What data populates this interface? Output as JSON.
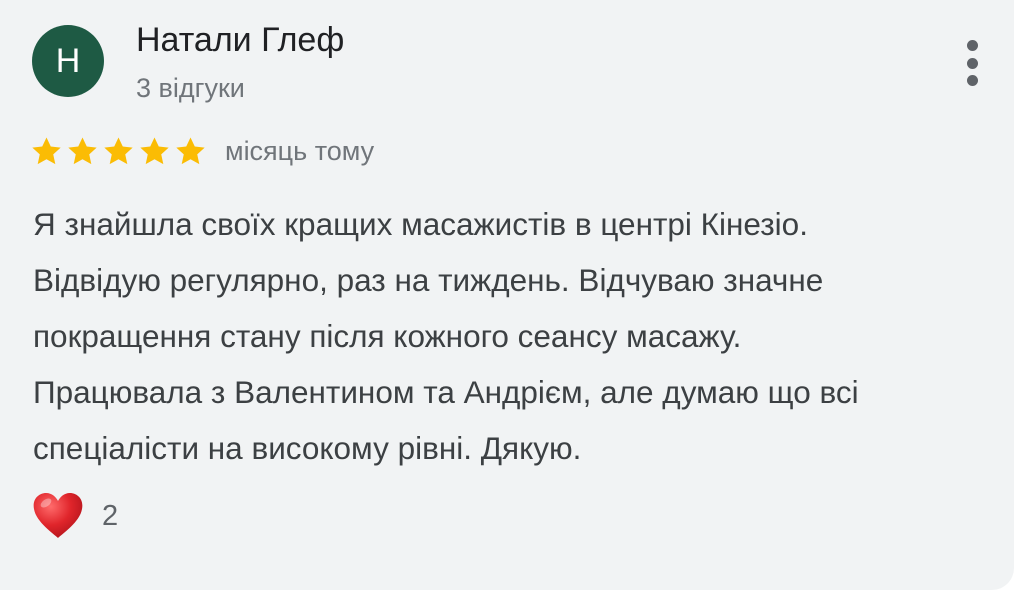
{
  "review": {
    "avatar_letter": "Н",
    "author_name": "Натали Глеф",
    "author_meta": "3 відгуки",
    "rating": 5,
    "max_rating": 5,
    "time": "місяць тому",
    "text_lines": [
      "Я знайшла своїх кращих масажистів в центрі Кінезіо.",
      "Відвідую регулярно, раз на тиждень. Відчуваю значне",
      "покращення стану після кожного сеансу масажу.",
      "Працювала з Валентином та Андрієм, але думаю що всі",
      "спеціалісти на високому рівні. Дякую."
    ],
    "reaction_icon": "heart-icon",
    "reaction_count": "2"
  },
  "colors": {
    "card_background": "#f1f3f4",
    "avatar_background": "#1e5a44",
    "star": "#fbbc04",
    "heart": "#e0252b"
  }
}
